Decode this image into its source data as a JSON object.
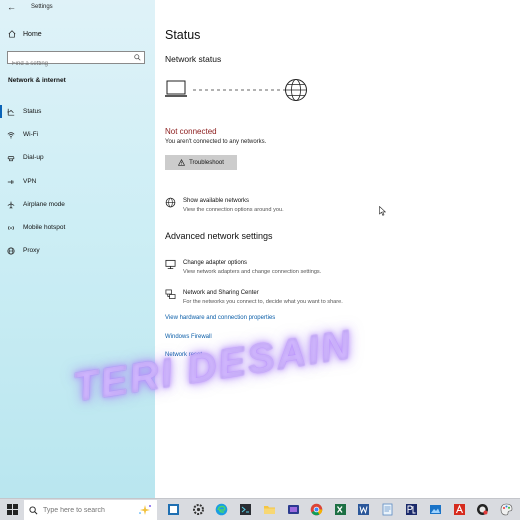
{
  "window": {
    "title": "Settings",
    "back_glyph": "←"
  },
  "sidebar": {
    "home_label": "Home",
    "search_placeholder": "Find a setting",
    "section_title": "Network & internet",
    "items": [
      {
        "label": "Status",
        "icon": "status-icon",
        "active": true
      },
      {
        "label": "Wi-Fi",
        "icon": "wifi-icon"
      },
      {
        "label": "Dial-up",
        "icon": "dialup-icon"
      },
      {
        "label": "VPN",
        "icon": "vpn-icon"
      },
      {
        "label": "Airplane mode",
        "icon": "airplane-icon"
      },
      {
        "label": "Mobile hotspot",
        "icon": "hotspot-icon"
      },
      {
        "label": "Proxy",
        "icon": "globe-icon"
      }
    ]
  },
  "main": {
    "title": "Status",
    "network_status_heading": "Network status",
    "connection_state": "Not connected",
    "connection_desc": "You aren't connected to any networks.",
    "troubleshoot_label": "Troubleshoot",
    "show_networks": {
      "title": "Show available networks",
      "desc": "View the connection options around you."
    },
    "advanced_heading": "Advanced network settings",
    "change_adapter": {
      "title": "Change adapter options",
      "desc": "View network adapters and change connection settings."
    },
    "sharing_center": {
      "title": "Network and Sharing Center",
      "desc": "For the networks you connect to, decide what you want to share."
    },
    "links": {
      "hardware": "View hardware and connection properties",
      "firewall": "Windows Firewall",
      "reset": "Network reset"
    }
  },
  "watermark": "TERI DESAIN",
  "taskbar": {
    "search_placeholder": "Type here to search",
    "apps": [
      "task-view",
      "settings",
      "edge",
      "terminal",
      "file-explorer",
      "folder",
      "chrome",
      "excel",
      "word",
      "notepad",
      "pl-app",
      "photos",
      "acrobat",
      "camera",
      "paint"
    ]
  },
  "colors": {
    "accent": "#0a63b7",
    "error": "#8b1b1b",
    "link": "#0b5ea8",
    "sidebar": "#cdeef5"
  }
}
